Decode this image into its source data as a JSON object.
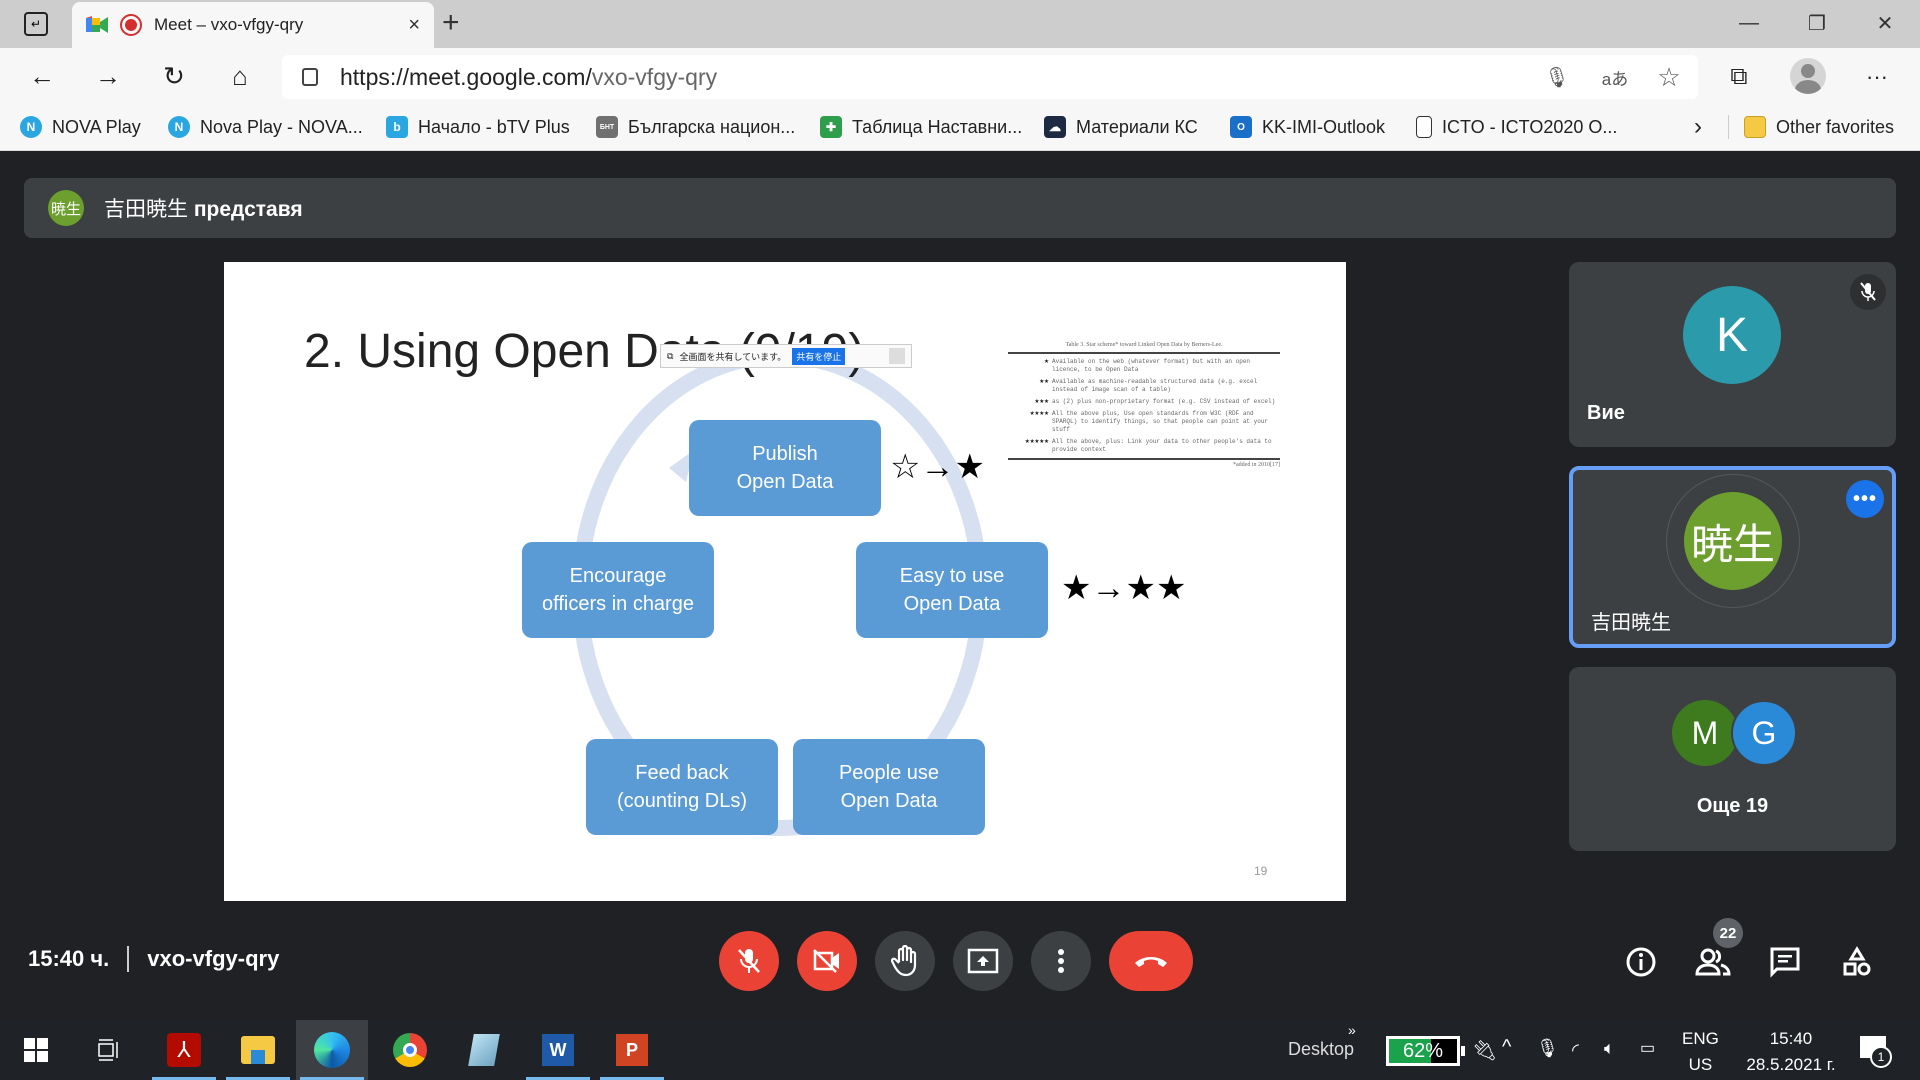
{
  "browser": {
    "tab": {
      "title": "Meet – vxo-vfgy-qry",
      "close": "×",
      "new_tab": "+"
    },
    "window_controls": {
      "minimize": "—",
      "restore": "❐",
      "close": "✕"
    },
    "nav": {
      "back": "←",
      "forward": "→",
      "reload": "↻",
      "home": "⌂"
    },
    "address": {
      "host": "https://meet.google.com/",
      "path": "vxo-vfgy-qry"
    },
    "address_icons": {
      "mic": "🎙",
      "read_aloud": "aあ",
      "favorite": "☆"
    },
    "toolbar_icons": {
      "collections": "⧉",
      "more": "···"
    },
    "bookmarks": [
      {
        "label": "NOVA Play",
        "icon": "nova-icon",
        "color": "#2aa7e0"
      },
      {
        "label": "Nova Play - NOVA...",
        "icon": "nova-icon",
        "color": "#2aa7e0"
      },
      {
        "label": "Начало - bTV Plus",
        "icon": "btv-icon",
        "color": "#2aa7e0"
      },
      {
        "label": "Българска национ...",
        "icon": "bnt-icon",
        "color": "#707070"
      },
      {
        "label": "Таблица Наставни...",
        "icon": "sheets-icon",
        "color": "#2e9d4c"
      },
      {
        "label": "Материали  КС",
        "icon": "cloud-icon",
        "color": "#1e2a44"
      },
      {
        "label": "KK-IMI-Outlook",
        "icon": "outlook-icon",
        "color": "#1a6fc9"
      },
      {
        "label": "ICTO - ICTO2020 O...",
        "icon": "page-icon",
        "color": "#ffffff"
      }
    ],
    "bookmarks_more": "›",
    "other_favorites": "Other favorites"
  },
  "meet": {
    "presenter": {
      "avatar": "暁生",
      "name": "吉田暁生",
      "suffix": "представя"
    },
    "slide": {
      "title": "2. Using Open Data (9/19)",
      "share_bar": {
        "text": "全画面を共有しています。",
        "stop": "共有を停止",
        "minimize": "_"
      },
      "cycle": [
        {
          "label": "Publish\nOpen Data",
          "stars": "☆→★"
        },
        {
          "label": "Easy to use\nOpen Data",
          "stars": "★→★★"
        },
        {
          "label": "People use\nOpen Data"
        },
        {
          "label": "Feed back\n(counting DLs)"
        },
        {
          "label": "Encourage\nofficers in charge"
        }
      ],
      "table": {
        "caption": "Table 3. Star scheme* toward Linked Open Data by Berners-Lee.",
        "rows": [
          {
            "stars": "★",
            "text": "Available on the web (whatever format) but with an open licence, to be Open Data"
          },
          {
            "stars": "★★",
            "text": "Available as machine-readable structured data (e.g. excel instead of image scan of a table)"
          },
          {
            "stars": "★★★",
            "text": "as (2) plus non-proprietary format (e.g. CSV instead of excel)"
          },
          {
            "stars": "★★★★",
            "text": "All the above plus, Use open standards from W3C (RDF and SPARQL) to identify things, so that people can point at your stuff"
          },
          {
            "stars": "★★★★★",
            "text": "All the above, plus: Link your data to other people's data to provide context"
          }
        ],
        "note": "*added in 2010[17]"
      },
      "page_number": "19"
    },
    "tiles": [
      {
        "avatar": "K",
        "name": "Вие",
        "avatar_color": "#2b9aaa",
        "muted": true
      },
      {
        "avatar": "暁生",
        "name": "吉田暁生",
        "avatar_color": "#6d9f2f",
        "active": true
      },
      {
        "avatars": [
          {
            "letter": "M",
            "color": "#3e7a1e"
          },
          {
            "letter": "G",
            "color": "#2b8ad8"
          }
        ],
        "name": "Още 19"
      }
    ],
    "bottom": {
      "time": "15:40 ч.",
      "meeting_code": "vxo-vfgy-qry",
      "participants_count": "22"
    }
  },
  "taskbar": {
    "desktop_label": "Desktop",
    "overflow": "»",
    "battery": {
      "percent": "62%",
      "level": 0.62
    },
    "language": {
      "line1": "ENG",
      "line2": "US"
    },
    "clock": {
      "time": "15:40",
      "date": "28.5.2021 г."
    },
    "notifications": "1"
  }
}
